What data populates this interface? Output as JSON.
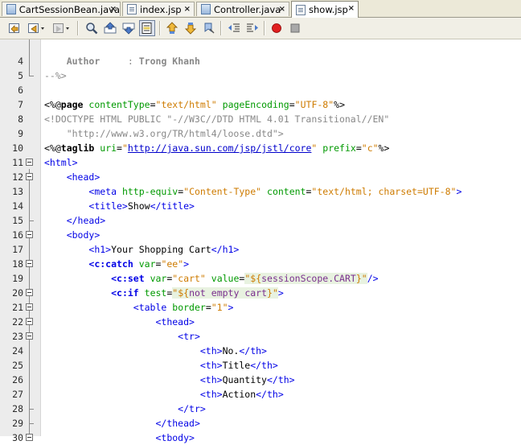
{
  "tabs": [
    {
      "label": "CartSessionBean.java",
      "icon": "java-file-icon",
      "active": false
    },
    {
      "label": "index.jsp",
      "icon": "jsp-file-icon",
      "active": false
    },
    {
      "label": "Controller.java",
      "icon": "java-file-icon",
      "active": false
    },
    {
      "label": "show.jsp",
      "icon": "jsp-file-icon",
      "active": true
    }
  ],
  "tab_close_glyph": "×",
  "line_numbers": [
    "4",
    "5",
    "6",
    "7",
    "8",
    "9",
    "10",
    "11",
    "12",
    "13",
    "14",
    "15",
    "16",
    "17",
    "18",
    "19",
    "20",
    "21",
    "22",
    "23",
    "24",
    "25",
    "26",
    "27",
    "28",
    "29",
    "30"
  ],
  "code": {
    "l4_label": "Author",
    "l4_sep": ":",
    "l4_name": "Trong Khanh",
    "l5": "--%>",
    "l7_open": "<%@",
    "l7_dir": "page",
    "l7_a1": "contentType",
    "l7_v1": "\"text/html\"",
    "l7_a2": "pageEncoding",
    "l7_v2": "\"UTF-8\"",
    "l7_close": "%>",
    "l8": "<!DOCTYPE HTML PUBLIC \"-//W3C//DTD HTML 4.01 Transitional//EN\"",
    "l9": "\"http://www.w3.org/TR/html4/loose.dtd\">",
    "l10_open": "<%@",
    "l10_dir": "taglib",
    "l10_a1": "uri",
    "l10_v1": "http://java.sun.com/jsp/jstl/core",
    "l10_a2": "prefix",
    "l10_v2": "\"c\"",
    "l10_close": "%>",
    "l11": "<html>",
    "l12": "<head>",
    "l13_tag": "<meta",
    "l13_a1": "http-equiv",
    "l13_v1": "\"Content-Type\"",
    "l13_a2": "content",
    "l13_v2": "\"text/html; charset=UTF-8\"",
    "l13_close": ">",
    "l14_o": "<title>",
    "l14_t": "Show",
    "l14_c": "</title>",
    "l15": "</head>",
    "l16": "<body>",
    "l17_o": "<h1>",
    "l17_t": "Your Shopping Cart",
    "l17_c": "</h1>",
    "l18_tag": "<c:catch",
    "l18_a": "var",
    "l18_v": "\"ee\"",
    "l18_c": ">",
    "l19_tag": "<c:set",
    "l19_a1": "var",
    "l19_v1": "\"cart\"",
    "l19_a2": "value",
    "l19_v2a": "\"${",
    "l19_el": "sessionScope.CART",
    "l19_v2b": "}\"",
    "l19_c": "/>",
    "l20_tag": "<c:if",
    "l20_a": "test",
    "l20_va": "\"${",
    "l20_el": "not empty cart",
    "l20_vb": "}\"",
    "l20_c": ">",
    "l21_tag": "<table",
    "l21_a": "border",
    "l21_v": "\"1\"",
    "l21_c": ">",
    "l22": "<thead>",
    "l23": "<tr>",
    "l24_o": "<th>",
    "l24_t": "No.",
    "l24_c": "</th>",
    "l25_o": "<th>",
    "l25_t": "Title",
    "l25_c": "</th>",
    "l26_o": "<th>",
    "l26_t": "Quantity",
    "l26_c": "</th>",
    "l27_o": "<th>",
    "l27_t": "Action",
    "l27_c": "</th>",
    "l28": "</tr>",
    "l29": "</thead>",
    "l30": "<tbody>"
  },
  "toolbar_icons": [
    "last-edit-icon",
    "back-icon",
    "forward-icon",
    "find-icon",
    "find-previous-icon",
    "find-next-icon",
    "toggle-highlight-icon",
    "previous-bookmark-icon",
    "next-bookmark-icon",
    "toggle-bookmark-icon",
    "shift-left-icon",
    "shift-right-icon",
    "record-macro-icon",
    "stop-macro-icon"
  ],
  "colors": {
    "tag": "#0000e6",
    "attribute": "#009900",
    "string": "#ce7b00",
    "comment": "#888888",
    "record": "#e02020"
  }
}
